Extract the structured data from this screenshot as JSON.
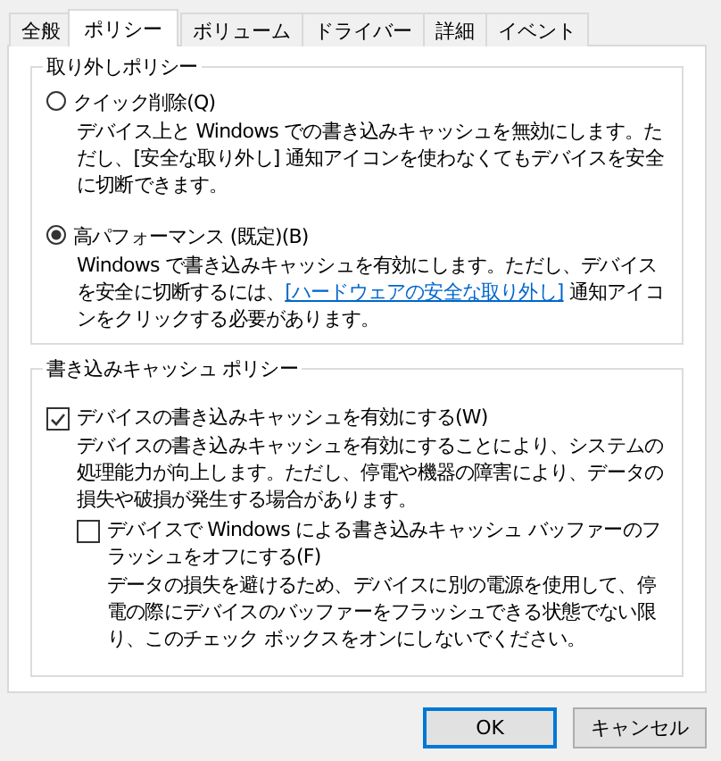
{
  "tabs": [
    {
      "label": "全般",
      "selected": false
    },
    {
      "label": "ポリシー",
      "selected": true
    },
    {
      "label": "ボリューム",
      "selected": false
    },
    {
      "label": "ドライバー",
      "selected": false
    },
    {
      "label": "詳細",
      "selected": false
    },
    {
      "label": "イベント",
      "selected": false
    }
  ],
  "removal_policy": {
    "title": "取り外しポリシー",
    "options": [
      {
        "label": "クイック削除(Q)",
        "selected": false,
        "description": "デバイス上と Windows での書き込みキャッシュを無効にします。ただし、[安全な取り外し] 通知アイコンを使わなくてもデバイスを安全に切断できます。"
      },
      {
        "label": "高パフォーマンス (既定)(B)",
        "selected": true,
        "description": "Windows で書き込みキャッシュを有効にします。ただし、デバイスを安全に切断するには、",
        "link": "[ハードウェアの安全な取り外し]",
        "description_after": " 通知アイコンをクリックする必要があります。"
      }
    ]
  },
  "write_cache_policy": {
    "title": "書き込みキャッシュ ポリシー",
    "options": [
      {
        "label": "デバイスの書き込みキャッシュを有効にする(W)",
        "checked": true,
        "description": "デバイスの書き込みキャッシュを有効にすることにより、システムの処理能力が向上します。ただし、停電や機器の障害により、データの損失や破損が発生する場合があります。"
      },
      {
        "label": "デバイスで Windows による書き込みキャッシュ バッファーのフラッシュをオフにする(F)",
        "checked": false,
        "description": "データの損失を避けるため、デバイスに別の電源を使用して、停電の際にデバイスのバッファーをフラッシュできる状態でない限り、このチェック ボックスをオンにしないでください。"
      }
    ]
  },
  "buttons": [
    {
      "label": "OK",
      "default": true
    },
    {
      "label": "キャンセル",
      "default": false
    }
  ]
}
